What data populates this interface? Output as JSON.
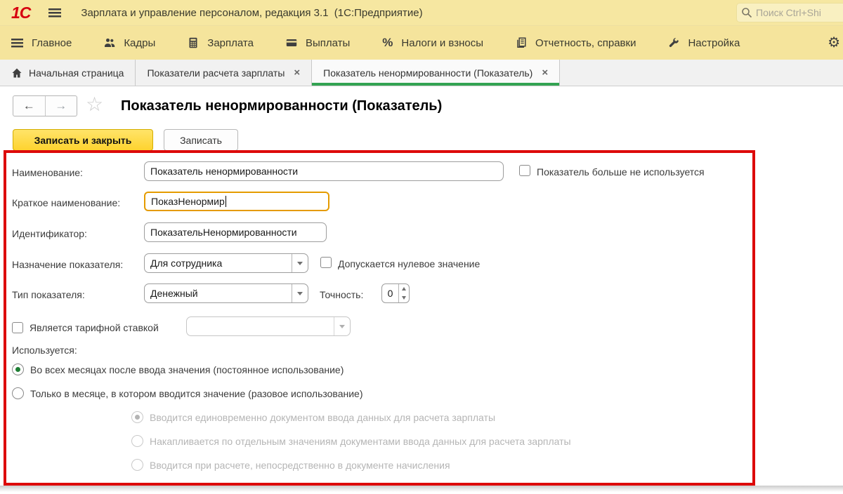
{
  "ui": {
    "logo_text": "1С",
    "close_glyph": "×",
    "star_glyph": "☆",
    "back_glyph": "←",
    "forward_glyph": "→",
    "gear_glyph": "⚙",
    "percent_glyph": "%",
    "colors": {
      "bar_yellow": "#f5e49c",
      "button_yellow": "#fed32f",
      "active_tab_green": "#33a352",
      "highlight_red": "#dd0a0a",
      "focus_orange": "#e59b00",
      "logo_red": "#d6000f"
    }
  },
  "titlebar": {
    "app_title": "Зарплата и управление персоналом, редакция 3.1  (1С:Предприятие)",
    "search_placeholder": "Поиск Ctrl+Shi"
  },
  "menubar": {
    "items": [
      {
        "label": "Главное",
        "icon": "menu-lines-icon"
      },
      {
        "label": "Кадры",
        "icon": "people-icon"
      },
      {
        "label": "Зарплата",
        "icon": "calculator-icon"
      },
      {
        "label": "Выплаты",
        "icon": "card-icon"
      },
      {
        "label": "Налоги и взносы",
        "icon": "percent-icon"
      },
      {
        "label": "Отчетность, справки",
        "icon": "documents-icon"
      },
      {
        "label": "Настройка",
        "icon": "wrench-icon"
      }
    ],
    "settings_icon": "gear-icon"
  },
  "tabs": [
    {
      "label": "Начальная страница",
      "icon": "home-icon",
      "closable": false,
      "active": false
    },
    {
      "label": "Показатели расчета зарплаты",
      "closable": true,
      "active": false
    },
    {
      "label": "Показатель ненормированности (Показатель)",
      "closable": true,
      "active": true
    }
  ],
  "page": {
    "title": "Показатель ненормированности (Показатель)",
    "toolbar": {
      "save_and_close": "Записать и закрыть",
      "save": "Записать"
    }
  },
  "form": {
    "fields": {
      "name": {
        "label": "Наименование:",
        "value": "Показатель ненормированности"
      },
      "short_name": {
        "label": "Краткое наименование:",
        "value": "ПоказНенормир",
        "focused": true
      },
      "identifier": {
        "label": "Идентификатор:",
        "value": "ПоказательНенормированности"
      },
      "purpose": {
        "label": "Назначение показателя:",
        "value": "Для сотрудника"
      },
      "type": {
        "label": "Тип показателя:",
        "value": "Денежный"
      },
      "precision": {
        "label": "Точность:",
        "value": "0"
      },
      "tariff_select": {
        "value": ""
      }
    },
    "checkboxes": {
      "not_used": {
        "label": "Показатель больше не используется",
        "checked": false
      },
      "zero_allowed": {
        "label": "Допускается нулевое значение",
        "checked": false
      },
      "tariff_rate": {
        "label": "Является тарифной ставкой",
        "checked": false
      }
    },
    "usage": {
      "label": "Используется:",
      "options": [
        {
          "label": "Во всех месяцах после ввода значения (постоянное использование)",
          "selected": true
        },
        {
          "label": "Только в месяце, в котором вводится значение (разовое использование)",
          "selected": false
        }
      ],
      "sub_options": [
        {
          "label": "Вводится единовременно документом ввода данных для расчета зарплаты",
          "selected": true,
          "disabled": true
        },
        {
          "label": "Накапливается по отдельным значениям документами ввода данных для расчета зарплаты",
          "selected": false,
          "disabled": true
        },
        {
          "label": "Вводится при расчете, непосредственно в документе начисления",
          "selected": false,
          "disabled": true
        }
      ]
    }
  }
}
